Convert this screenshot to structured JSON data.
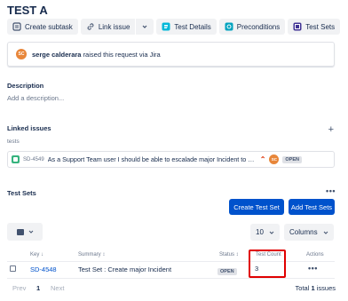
{
  "issue_title": "TEST A",
  "toolbar": {
    "create_subtask": "Create subtask",
    "link_issue": "Link issue",
    "test_details": "Test Details",
    "preconditions": "Preconditions",
    "test_sets": "Test Sets"
  },
  "raised": {
    "avatar_initials": "SC",
    "user": "serge calderara",
    "text": "raised this request via Jira"
  },
  "description": {
    "label": "Description",
    "placeholder": "Add a description..."
  },
  "linked_issues": {
    "label": "Linked issues",
    "relation": "tests",
    "add_symbol": "+",
    "items": [
      {
        "key": "SD-4549",
        "summary": "As a Support Team user I should be able to escalade major Incident to L2 and L3 ...",
        "assignee_initials": "SC",
        "status": "OPEN"
      }
    ]
  },
  "test_sets": {
    "label": "Test Sets",
    "more": "•••",
    "create_button": "Create Test Set",
    "add_button": "Add Test Sets",
    "page_size": "10",
    "columns_label": "Columns",
    "headers": {
      "key": "Key",
      "summary": "Summary",
      "status": "Status",
      "test_count": "Test Count",
      "actions": "Actions"
    },
    "rows": [
      {
        "key": "SD-4548",
        "summary": "Test Set : Create major Incident",
        "status": "OPEN",
        "test_count": "3",
        "actions": "•••"
      }
    ],
    "pager": {
      "prev": "Prev",
      "page": "1",
      "next": "Next"
    },
    "total_prefix": "Total",
    "total_count": "1",
    "total_suffix": "issues"
  },
  "colors": {
    "primary": "#0052cc",
    "highlight": "#e00000",
    "avatar": "#e8863a",
    "story": "#36b37e"
  }
}
